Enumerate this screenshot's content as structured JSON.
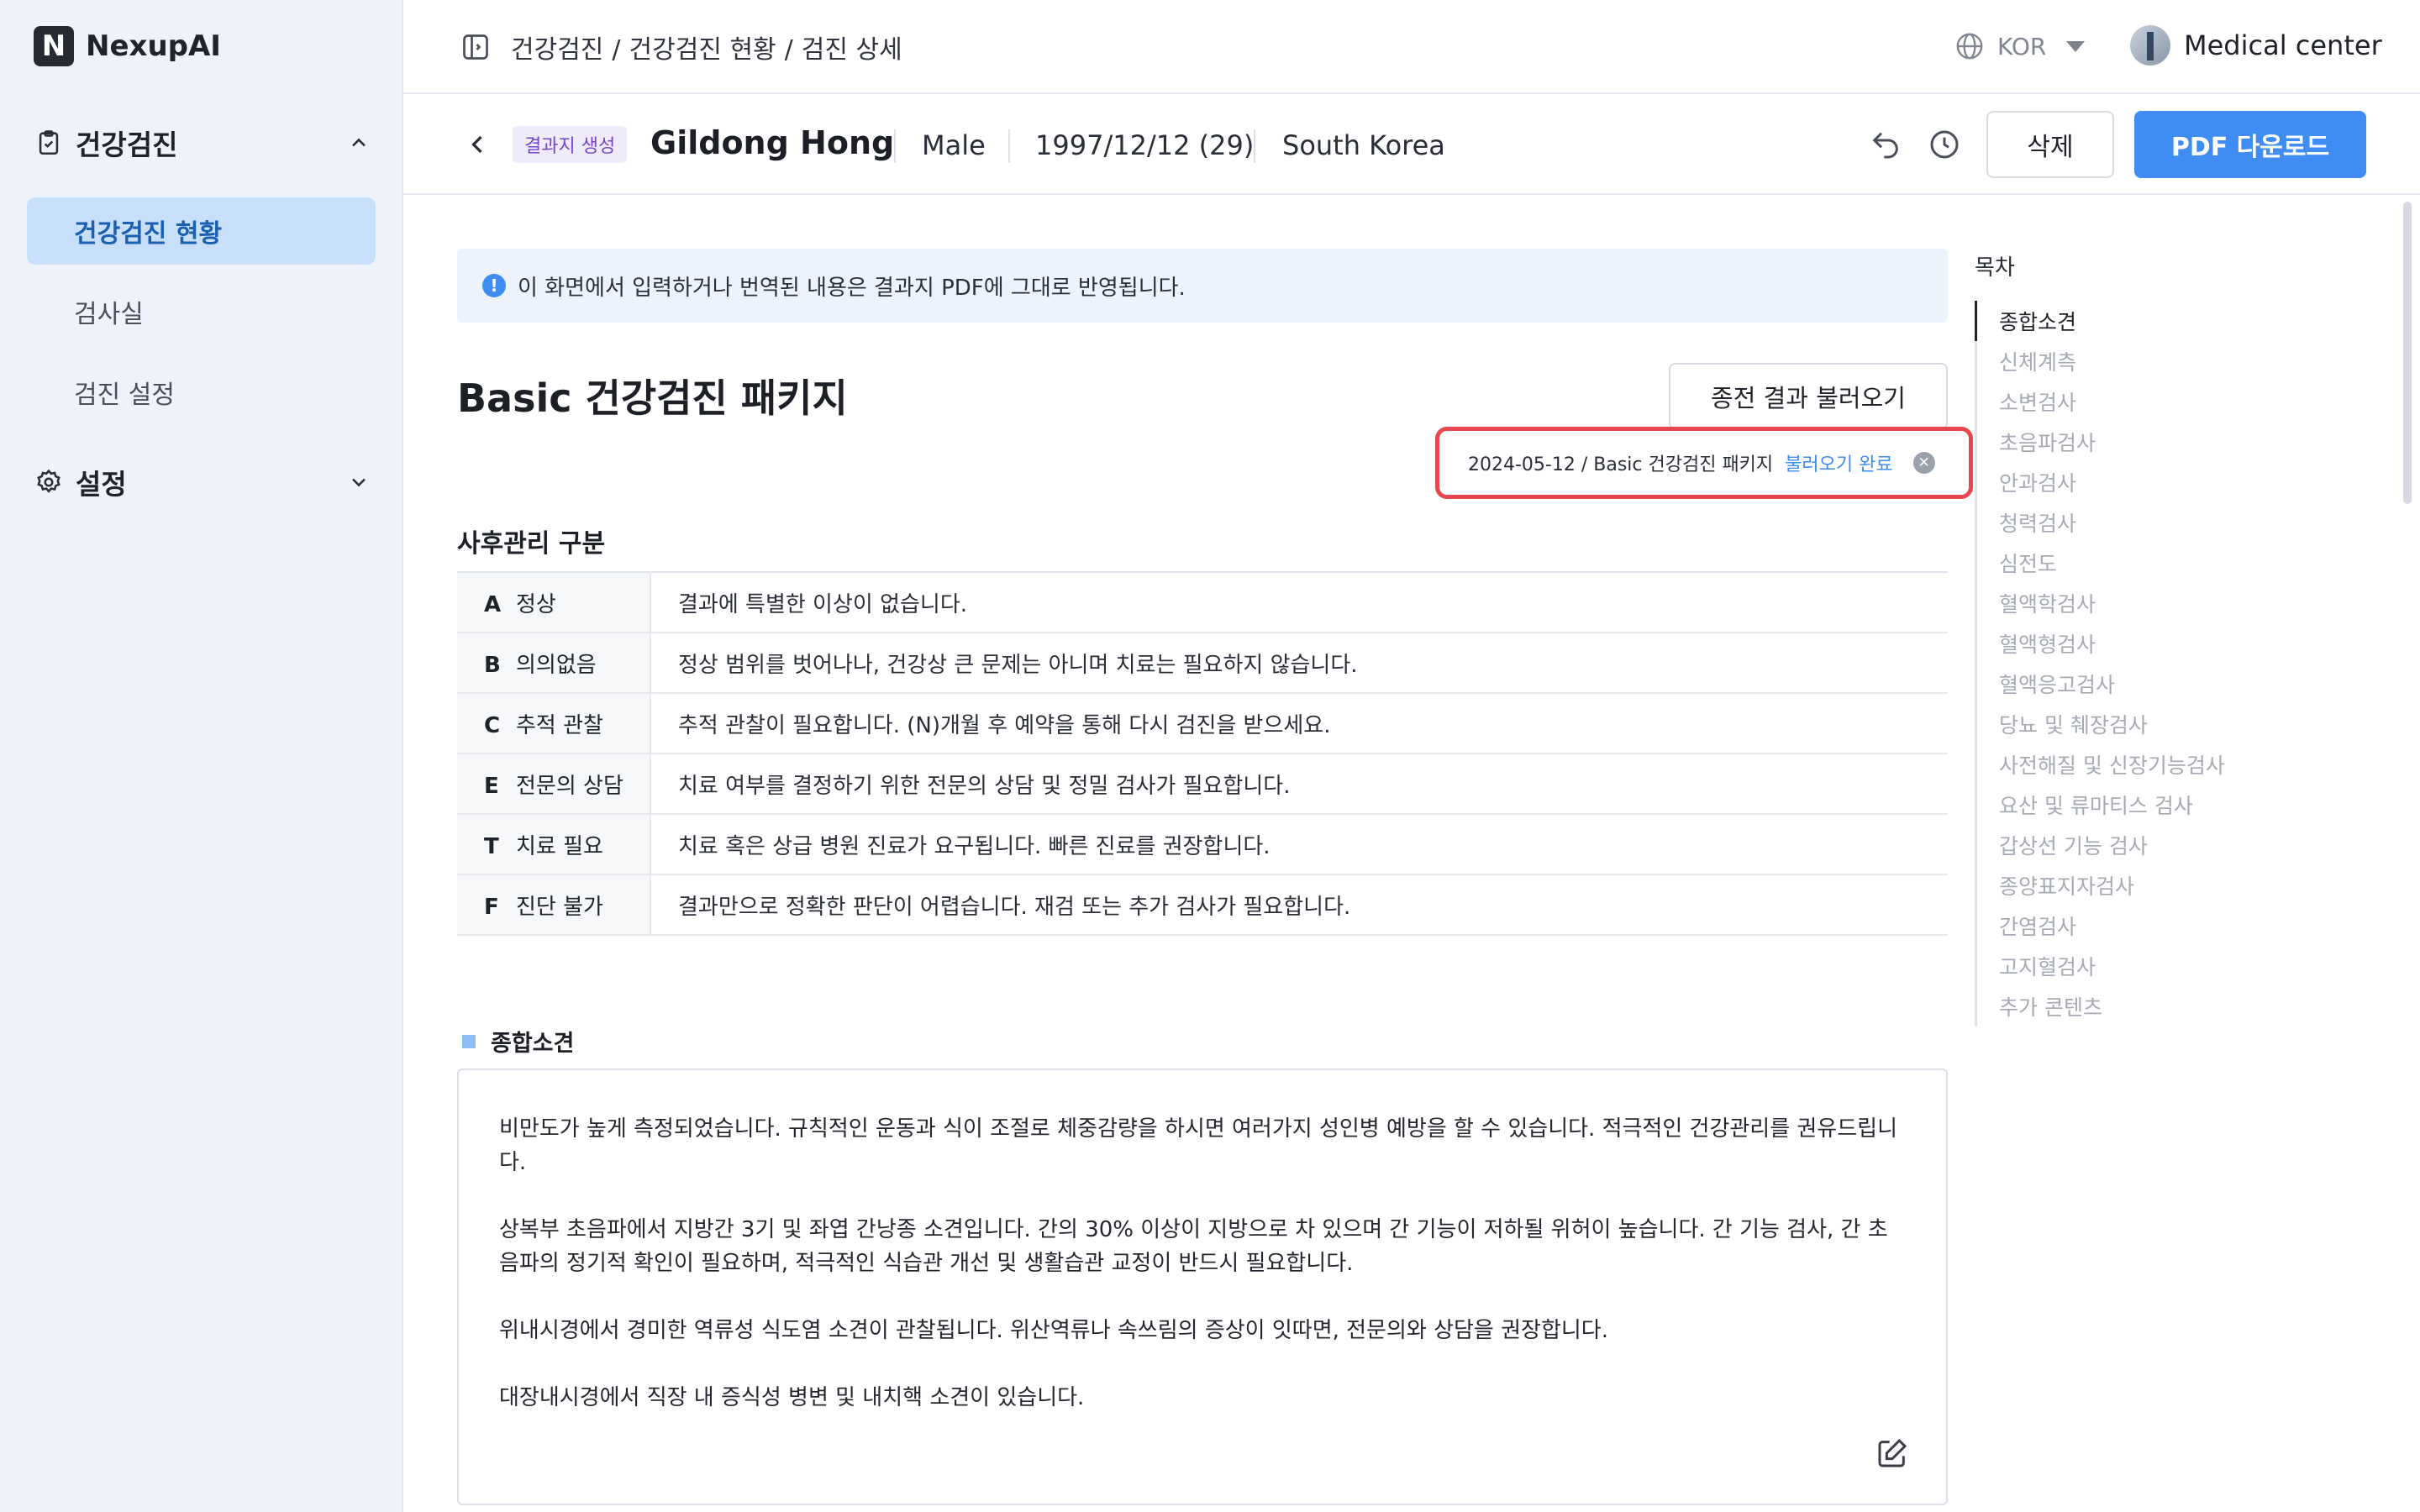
{
  "app": {
    "logo_letter": "N",
    "name": "NexupAI"
  },
  "sidebar": {
    "groups": [
      {
        "label": "건강검진",
        "expanded": true
      },
      {
        "label": "설정",
        "expanded": false
      }
    ],
    "items": [
      {
        "label": "건강검진 현황",
        "active": true
      },
      {
        "label": "검사실",
        "active": false
      },
      {
        "label": "검진 설정",
        "active": false
      }
    ]
  },
  "topbar": {
    "breadcrumb": [
      "건강검진",
      "건강검진 현황",
      "검진 상세"
    ],
    "language": "KOR",
    "organization": "Medical center"
  },
  "patient": {
    "status_tag": "결과지 생성",
    "name": "Gildong Hong",
    "gender": "Male",
    "birth": "1997/12/12 (29)",
    "country": "South Korea",
    "delete_label": "삭제",
    "pdf_label": "PDF 다운로드"
  },
  "notice": "이 화면에서 입력하거나 번역된 내용은 결과지 PDF에 그대로 반영됩니다.",
  "package": {
    "title": "Basic 건강검진 패키지",
    "load_button": "종전 결과 불러오기",
    "loaded_text": "2024-05-12 / Basic 건강검진 패키지",
    "loaded_status": "불러오기 완료"
  },
  "grades": {
    "title": "사후관리 구분",
    "rows": [
      {
        "code": "A",
        "name": "정상",
        "desc": "결과에 특별한 이상이 없습니다."
      },
      {
        "code": "B",
        "name": "의의없음",
        "desc": "정상 범위를 벗어나나, 건강상 큰 문제는 아니며 치료는 필요하지 않습니다."
      },
      {
        "code": "C",
        "name": "추적 관찰",
        "desc": "추적 관찰이 필요합니다. (N)개월 후 예약을 통해 다시 검진을 받으세요."
      },
      {
        "code": "E",
        "name": "전문의 상담",
        "desc": "치료 여부를 결정하기 위한 전문의 상담 및 정밀 검사가 필요합니다."
      },
      {
        "code": "T",
        "name": "치료 필요",
        "desc": "치료 혹은 상급 병원 진료가 요구됩니다. 빠른 진료를 권장합니다."
      },
      {
        "code": "F",
        "name": "진단 불가",
        "desc": "결과만으로 정확한 판단이 어렵습니다. 재검 또는 추가 검사가 필요합니다."
      }
    ]
  },
  "opinion": {
    "title": "종합소견",
    "paragraphs": [
      "비만도가 높게 측정되었습니다. 규칙적인 운동과 식이 조절로 체중감량을 하시면 여러가지 성인병 예방을 할 수 있습니다. 적극적인 건강관리를 권유드립니다.",
      "상복부 초음파에서 지방간 3기 및 좌엽 간낭종 소견입니다. 간의 30% 이상이 지방으로 차 있으며 간 기능이 저하될 위허이 높습니다. 간 기능 검사, 간 초음파의 정기적 확인이 필요하며, 적극적인 식습관 개선 및 생활습관 교정이 반드시 필요합니다.",
      "위내시경에서 경미한 역류성 식도염 소견이 관찰됩니다. 위산역류나 속쓰림의 증상이 잇따면, 전문의와 상담을 권장합니다.",
      "대장내시경에서 직장 내 증식성 병변 및 내치핵 소견이 있습니다."
    ]
  },
  "toc": {
    "title": "목차",
    "items": [
      "종합소견",
      "신체계측",
      "소변검사",
      "초음파검사",
      "안과검사",
      "청력검사",
      "심전도",
      "혈액학검사",
      "혈액형검사",
      "혈액응고검사",
      "당뇨 및 췌장검사",
      "사전해질 및 신장기능검사",
      "요산 및 류마티스 검사",
      "갑상선 기능 검사",
      "종양표지자검사",
      "간염검사",
      "고지혈검사",
      "추가 콘텐츠"
    ],
    "active_index": 0
  },
  "icons": {
    "group_1": "clipboard-icon",
    "group_2": "gear-icon",
    "panel": "sidebar-toggle-icon",
    "language": "globe-icon",
    "back": "chevron-left-icon",
    "undo": "undo-icon",
    "history": "clock-icon",
    "info": "info-icon",
    "clear": "close-circle-icon",
    "edit": "edit-icon"
  },
  "colors": {
    "primary": "#3f8df3",
    "highlight_border": "#e8474f",
    "status_tag": "#7346c8",
    "active_nav_bg": "#c8dff9"
  }
}
